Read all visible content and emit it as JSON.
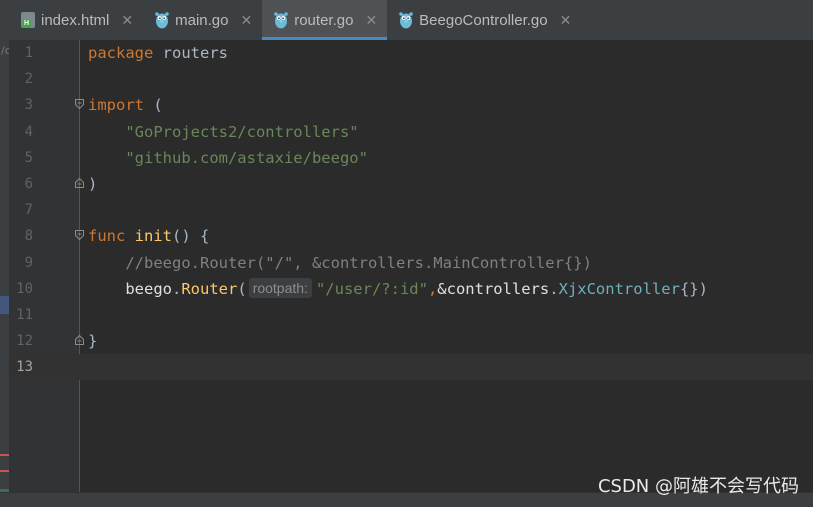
{
  "tabs": [
    {
      "label": "index.html",
      "icon": "html-file-icon",
      "active": false
    },
    {
      "label": "main.go",
      "icon": "go-file-icon",
      "active": false
    },
    {
      "label": "router.go",
      "icon": "go-file-icon",
      "active": true
    },
    {
      "label": "BeegoController.go",
      "icon": "go-file-icon",
      "active": false
    }
  ],
  "tab_close_glyph": "✕",
  "line_numbers": [
    "1",
    "2",
    "3",
    "4",
    "5",
    "6",
    "7",
    "8",
    "9",
    "10",
    "11",
    "12",
    "13"
  ],
  "current_line": 13,
  "code": {
    "l1_kw": "package",
    "l1_name": " routers",
    "l3_kw": "import",
    "l3_rest": " (",
    "l4_str": "\"GoProjects2/controllers\"",
    "l5_str": "\"github.com/astaxie/beego\"",
    "l6_close": ")",
    "l8_kw": "func",
    "l8_fn": "init",
    "l8_rest": "() {",
    "l9_comment": "//beego.Router(\"/\", &controllers.MainController{})",
    "l10_pkg": "beego",
    "l10_dot": ".",
    "l10_fn": "Router",
    "l10_paren": "(",
    "l10_hint": "rootpath:",
    "l10_str": "\"/user/?:id\"",
    "l10_comma": ",",
    "l10_amp": "&controllers",
    "l10_dot2": ".",
    "l10_type": "XjxController",
    "l10_end": "{})",
    "l12_close": "}"
  },
  "left_strip_hint": "/c",
  "watermark": "CSDN @阿雄不会写代码",
  "colors": {
    "keyword": "#cc7832",
    "string": "#6a8759",
    "comment": "#808080",
    "function": "#ffc66d",
    "type": "#6fafbd",
    "background": "#2b2b2b",
    "active_tab_underline": "#4a88c7"
  }
}
